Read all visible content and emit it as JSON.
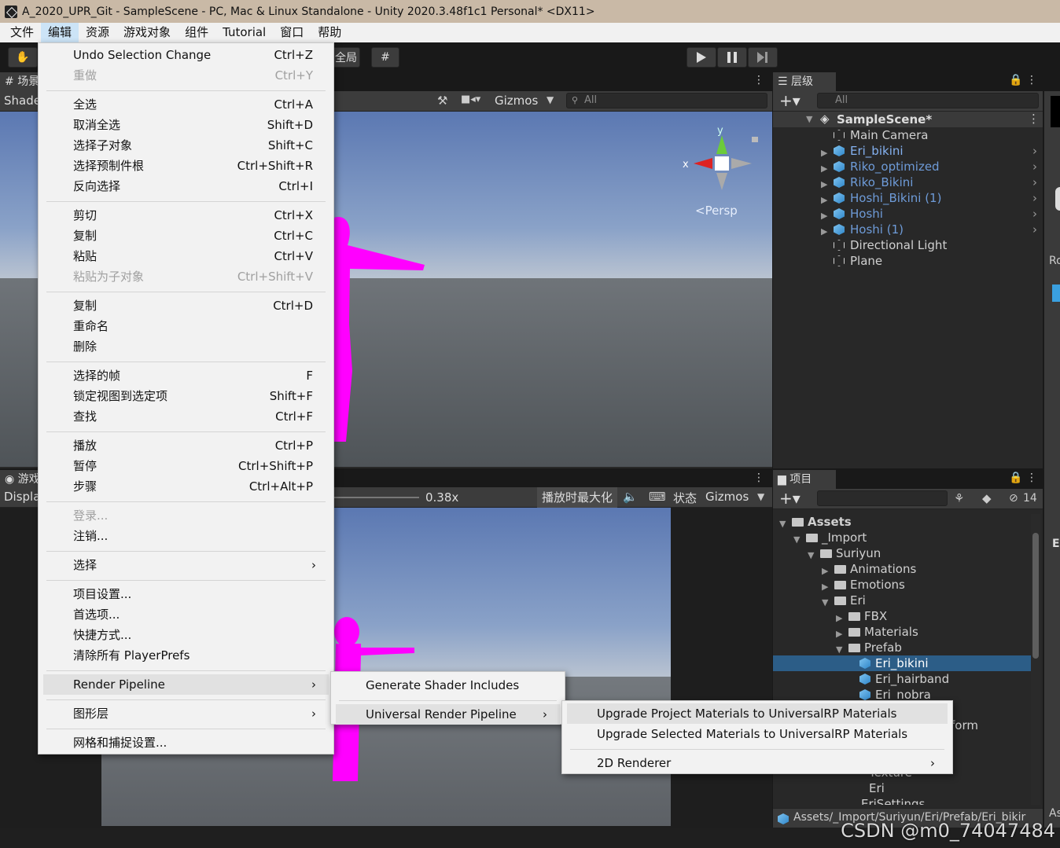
{
  "window": {
    "title": "A_2020_UPR_Git - SampleScene - PC, Mac & Linux Standalone - Unity 2020.3.48f1c1 Personal* <DX11>"
  },
  "menubar": {
    "items": [
      "文件",
      "编辑",
      "资源",
      "游戏对象",
      "组件",
      "Tutorial",
      "窗口",
      "帮助"
    ],
    "active": "编辑"
  },
  "toolbar": {
    "global_label": "全局",
    "play_icon": "play-icon",
    "pause_icon": "pause-icon",
    "step_icon": "step-icon"
  },
  "scene_view": {
    "tab_label": "场景",
    "shading_label": "Shaded",
    "gizmos_label": "Gizmos",
    "search_placeholder": "All",
    "persp_label": "<Persp",
    "axis_y": "y",
    "axis_x": "x"
  },
  "game_view": {
    "tab_label": "游戏",
    "display_label": "Display",
    "scale_value": "0.38x",
    "maximize_label": "播放时最大化",
    "stats_label": "状态",
    "gizmos_label": "Gizmos"
  },
  "hierarchy": {
    "tab_label": "层级",
    "search_placeholder": "All",
    "scene_name": "SampleScene*",
    "items": [
      {
        "label": "Main Camera",
        "kind": "object"
      },
      {
        "label": "Eri_bikini",
        "kind": "prefab-bright"
      },
      {
        "label": "Riko_optimized",
        "kind": "prefab"
      },
      {
        "label": "Riko_Bikini",
        "kind": "prefab"
      },
      {
        "label": "Hoshi_Bikini (1)",
        "kind": "prefab"
      },
      {
        "label": "Hoshi",
        "kind": "prefab"
      },
      {
        "label": "Hoshi (1)",
        "kind": "prefab"
      },
      {
        "label": "Directional Light",
        "kind": "object"
      },
      {
        "label": "Plane",
        "kind": "object"
      }
    ]
  },
  "project": {
    "tab_label": "项目",
    "hidden_count": "14",
    "tree": [
      {
        "label": "Assets",
        "depth": 0,
        "bold": true
      },
      {
        "label": "_Import",
        "depth": 1
      },
      {
        "label": "Suriyun",
        "depth": 2
      },
      {
        "label": "Animations",
        "depth": 3
      },
      {
        "label": "Emotions",
        "depth": 3
      },
      {
        "label": "Eri",
        "depth": 3
      },
      {
        "label": "FBX",
        "depth": 4
      },
      {
        "label": "Materials",
        "depth": 4
      },
      {
        "label": "Prefab",
        "depth": 4
      },
      {
        "label": "Eri_bikini",
        "depth": 5,
        "selected": true
      },
      {
        "label": "Eri_hairband",
        "depth": 5
      },
      {
        "label": "Eri_nobra",
        "depth": 5
      }
    ],
    "partial_rows": [
      "form",
      "Texture",
      "Eri",
      "EriSettings"
    ],
    "path": "Assets/_Import/Suriyun/Eri/Prefab/Eri_bikir"
  },
  "inspector_edge": {
    "label_ro": "Ro",
    "label_e": "E",
    "label_as": "As"
  },
  "edit_menu": {
    "items": [
      {
        "label": "Undo Selection Change",
        "shortcut": "Ctrl+Z"
      },
      {
        "label": "重做",
        "shortcut": "Ctrl+Y",
        "disabled": true
      },
      {
        "sep": true
      },
      {
        "label": "全选",
        "shortcut": "Ctrl+A"
      },
      {
        "label": "取消全选",
        "shortcut": "Shift+D"
      },
      {
        "label": "选择子对象",
        "shortcut": "Shift+C"
      },
      {
        "label": "选择预制件根",
        "shortcut": "Ctrl+Shift+R"
      },
      {
        "label": "反向选择",
        "shortcut": "Ctrl+I"
      },
      {
        "sep": true
      },
      {
        "label": "剪切",
        "shortcut": "Ctrl+X"
      },
      {
        "label": "复制",
        "shortcut": "Ctrl+C"
      },
      {
        "label": "粘贴",
        "shortcut": "Ctrl+V"
      },
      {
        "label": "粘贴为子对象",
        "shortcut": "Ctrl+Shift+V",
        "disabled": true
      },
      {
        "sep": true
      },
      {
        "label": "复制",
        "shortcut": "Ctrl+D"
      },
      {
        "label": "重命名",
        "shortcut": ""
      },
      {
        "label": "删除",
        "shortcut": ""
      },
      {
        "sep": true
      },
      {
        "label": "选择的帧",
        "shortcut": "F"
      },
      {
        "label": "锁定视图到选定项",
        "shortcut": "Shift+F"
      },
      {
        "label": "查找",
        "shortcut": "Ctrl+F"
      },
      {
        "sep": true
      },
      {
        "label": "播放",
        "shortcut": "Ctrl+P"
      },
      {
        "label": "暂停",
        "shortcut": "Ctrl+Shift+P"
      },
      {
        "label": "步骤",
        "shortcut": "Ctrl+Alt+P"
      },
      {
        "sep": true
      },
      {
        "label": "登录...",
        "shortcut": "",
        "disabled": true
      },
      {
        "label": "注销...",
        "shortcut": ""
      },
      {
        "sep": true
      },
      {
        "label": "选择",
        "shortcut": "",
        "submenu": true
      },
      {
        "sep": true
      },
      {
        "label": "项目设置...",
        "shortcut": ""
      },
      {
        "label": "首选项...",
        "shortcut": ""
      },
      {
        "label": "快捷方式...",
        "shortcut": ""
      },
      {
        "label": "清除所有 PlayerPrefs",
        "shortcut": ""
      },
      {
        "sep": true
      },
      {
        "label": "Render Pipeline",
        "shortcut": "",
        "submenu": true,
        "highlighted": true
      },
      {
        "sep": true
      },
      {
        "label": "图形层",
        "shortcut": "",
        "submenu": true
      },
      {
        "sep": true
      },
      {
        "label": "网格和捕捉设置...",
        "shortcut": ""
      }
    ]
  },
  "render_pipeline_menu": {
    "items": [
      {
        "label": "Generate Shader Includes"
      },
      {
        "sep": true
      },
      {
        "label": "Universal Render Pipeline",
        "submenu": true,
        "highlighted": true
      }
    ]
  },
  "urp_menu": {
    "items": [
      {
        "label": "Upgrade Project Materials to UniversalRP Materials",
        "highlighted": true
      },
      {
        "label": "Upgrade Selected Materials to UniversalRP Materials"
      },
      {
        "sep": true
      },
      {
        "label": "2D Renderer",
        "submenu": true
      }
    ]
  },
  "watermark": "CSDN @m0_74047484",
  "colors": {
    "menu_bg": "#f2f2f2",
    "selection": "#2c5d87",
    "model_magenta": "#ff00ff",
    "prefab_text": "#6e9bd8"
  }
}
